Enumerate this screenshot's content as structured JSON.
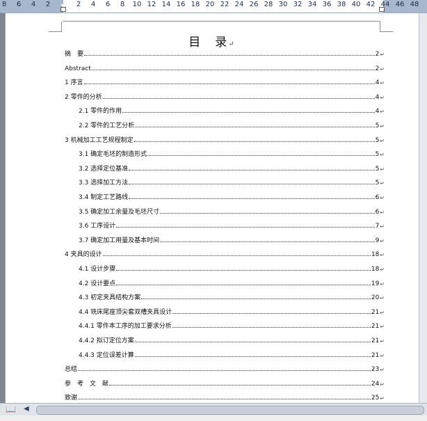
{
  "ruler": {
    "left_numbers": [
      "8",
      "6",
      "4",
      "2"
    ],
    "right_numbers": [
      "2",
      "4",
      "6",
      "8",
      "10",
      "12",
      "14",
      "16",
      "18",
      "20",
      "22",
      "24",
      "26",
      "28",
      "30",
      "32",
      "34",
      "36",
      "38",
      "40",
      "42",
      "44",
      "46",
      "48"
    ]
  },
  "title": "目　录",
  "return_mark": "↵",
  "toc": [
    {
      "label": "摘　要",
      "page": "2"
    },
    {
      "label": "Abstract",
      "page": "2"
    },
    {
      "label": "1 序言",
      "page": "4"
    },
    {
      "label": "2 零件的分析",
      "page": "4"
    },
    {
      "label": "2.1 零件的作用",
      "page": "4"
    },
    {
      "label": "2.2 零件的工艺分析",
      "page": "5"
    },
    {
      "label": "3 机械加工工艺规程制定",
      "page": "5"
    },
    {
      "label": "3.1 确定毛坯的制造形式",
      "page": "5"
    },
    {
      "label": "3.2 选择定位基准",
      "page": "5"
    },
    {
      "label": "3.3 选择加工方法",
      "page": "5"
    },
    {
      "label": "3.4 制定工艺路线",
      "page": "6"
    },
    {
      "label": "3.5 确定加工余量及毛坯尺寸",
      "page": "6"
    },
    {
      "label": "3.6 工序设计",
      "page": "7"
    },
    {
      "label": "3.7 确定加工用量及基本时间",
      "page": "9"
    },
    {
      "label": "4 夹具的设计",
      "page": "18"
    },
    {
      "label": "4.1 设计步骤",
      "page": "18"
    },
    {
      "label": "4.2 设计要点",
      "page": "19"
    },
    {
      "label": "4.3 初定夹具结构方案",
      "page": "20"
    },
    {
      "label": "4.4 铣床尾座顶尖套双槽夹具设计",
      "page": "21"
    },
    {
      "label": "4.4.1 零件本工序的加工要求分析",
      "page": "21"
    },
    {
      "label": "4.4.2 拟订定位方案",
      "page": "21"
    },
    {
      "label": "4.4.3 定位误差计算",
      "page": "21"
    },
    {
      "label": "总结",
      "page": "23"
    },
    {
      "label": "参　考　文　献",
      "page": "24"
    },
    {
      "label": "致谢",
      "page": "25"
    }
  ],
  "icons": {
    "page_view": "book-icon",
    "scroll_left": "arrow-left-icon"
  }
}
